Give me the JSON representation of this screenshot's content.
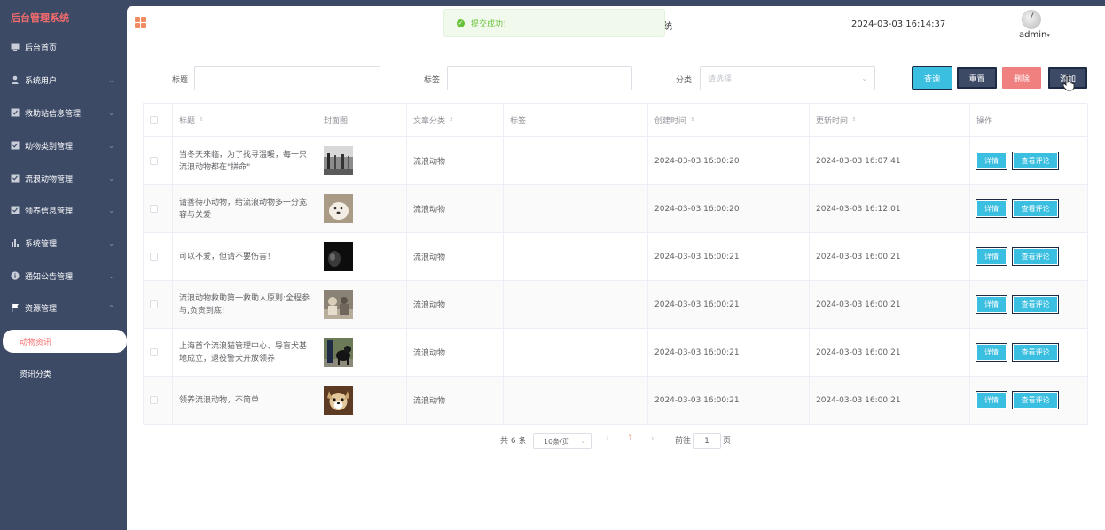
{
  "sidebar": {
    "brand": "后台管理系统",
    "items": [
      {
        "label": "后台首页",
        "icon": "monitor-icon",
        "arrow": ""
      },
      {
        "label": "系统用户",
        "icon": "user-icon",
        "arrow": "⌄"
      },
      {
        "label": "救助站信息管理",
        "icon": "checkbox-icon",
        "arrow": "⌄"
      },
      {
        "label": "动物类别管理",
        "icon": "checkbox-icon",
        "arrow": "⌄"
      },
      {
        "label": "流浪动物管理",
        "icon": "checkbox-icon",
        "arrow": "⌄"
      },
      {
        "label": "领养信息管理",
        "icon": "checkbox-icon",
        "arrow": "⌄"
      },
      {
        "label": "系统管理",
        "icon": "bar-chart-icon",
        "arrow": "⌄"
      },
      {
        "label": "通知公告管理",
        "icon": "info-icon",
        "arrow": "⌄"
      },
      {
        "label": "资源管理",
        "icon": "flag-icon",
        "arrow": "⌃"
      }
    ],
    "sub_items": [
      {
        "label": "动物资讯",
        "active": true
      },
      {
        "label": "资讯分类",
        "active": false
      }
    ]
  },
  "header": {
    "fragment": "统",
    "datetime": "2024-03-03 16:14:37",
    "user": "admin"
  },
  "toast": {
    "text": "提交成功！",
    "color": "#67c23a"
  },
  "search": {
    "title_label": "标题",
    "tag_label": "标签",
    "category_label": "分类",
    "category_placeholder": "请选择",
    "query_label": "查询",
    "reset_label": "重置",
    "delete_label": "删除",
    "add_label": "添加"
  },
  "table": {
    "columns": [
      "标题",
      "封面图",
      "文章分类",
      "标签",
      "创建时间",
      "更新时间",
      "操作"
    ],
    "rows": [
      {
        "title": "当冬天来临，为了找寻温暖，每一只流浪动物都在\"拼命\"",
        "category": "流浪动物",
        "tag": "",
        "created": "2024-03-03 16:00:20",
        "updated": "2024-03-03 16:07:41"
      },
      {
        "title": "请善待小动物，给流浪动物多一分宽容与关爱",
        "category": "流浪动物",
        "tag": "",
        "created": "2024-03-03 16:00:20",
        "updated": "2024-03-03 16:12:01"
      },
      {
        "title": "可以不爱，但请不要伤害！",
        "category": "流浪动物",
        "tag": "",
        "created": "2024-03-03 16:00:21",
        "updated": "2024-03-03 16:00:21"
      },
      {
        "title": "流浪动物救助第一救助人原则:全程参与,负责到底!",
        "category": "流浪动物",
        "tag": "",
        "created": "2024-03-03 16:00:21",
        "updated": "2024-03-03 16:00:21"
      },
      {
        "title": "上海首个流浪猫管理中心、导盲犬基地成立，退役警犬开放领养",
        "category": "流浪动物",
        "tag": "",
        "created": "2024-03-03 16:00:21",
        "updated": "2024-03-03 16:00:21"
      },
      {
        "title": "领养流浪动物，不简单",
        "category": "流浪动物",
        "tag": "",
        "created": "2024-03-03 16:00:21",
        "updated": "2024-03-03 16:00:21"
      }
    ],
    "detail_label": "详情",
    "comment_label": "查看评论"
  },
  "pagination": {
    "total": "共 6 条",
    "page_size": "10条/页",
    "prev": "‹",
    "current": "1",
    "next": "›",
    "goto_label": "前往",
    "goto_value": "1",
    "page_suffix": "页"
  },
  "colors": {
    "sidebar": "#3c4a66",
    "accent": "#f56c6c",
    "primary": "#3bbfe0",
    "danger": "#f08080"
  }
}
